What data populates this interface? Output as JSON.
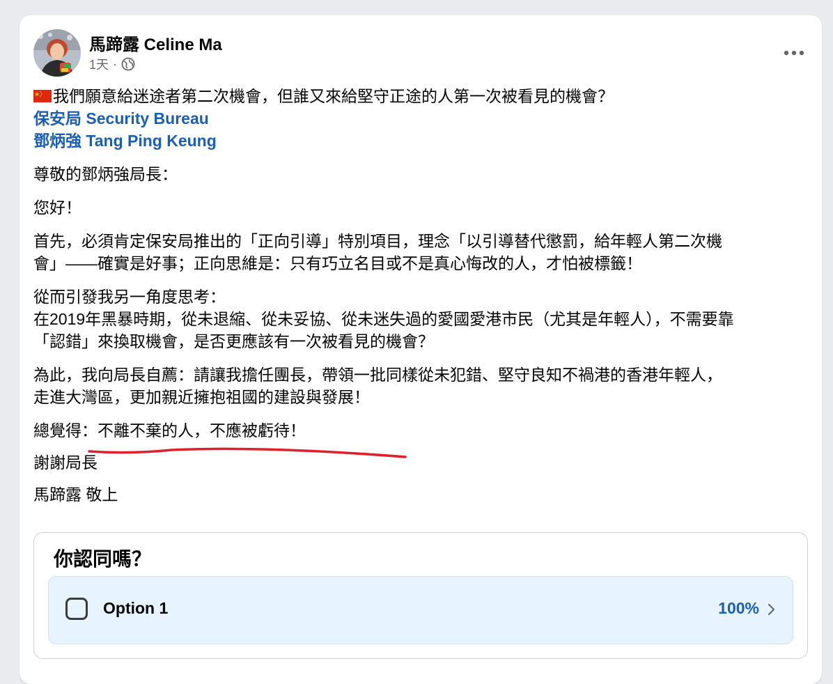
{
  "post": {
    "author": "馬蹄露 Celine Ma",
    "time": "1天",
    "separator": "·",
    "audience_icon": "globe-icon",
    "more_icon": "more-horizontal-icon"
  },
  "content": {
    "title": "我們願意給迷途者第二次機會，但誰又來給堅守正途的人第一次被看見的機會？",
    "flag_icon": "china-flag-icon",
    "tags": [
      "保安局 Security Bureau",
      "鄧炳強 Tang Ping Keung"
    ],
    "greeting": "尊敬的鄧炳強局長：",
    "hello": "您好！",
    "para1": [
      "首先，必須肯定保安局推出的「正向引導」特別項目，理念「以引導替代懲罰，給年輕人第二次機",
      "會」——確實是好事；正向思維是：只有巧立名目或不是真心悔改的人，才怕被標籤！"
    ],
    "para2": [
      "從而引發我另一角度思考：",
      "在2019年黑暴時期，從未退縮、從未妥協、從未迷失過的愛國愛港市民（尤其是年輕人），不需要靠",
      "「認錯」來換取機會，是否更應該有一次被看見的機會？"
    ],
    "para3": [
      "為此，我向局長自薦：請讓我擔任團長，帶領一批同樣從未犯錯、堅守良知不禍港的香港年輕人，",
      "走進大灣區，更加親近擁抱祖國的建設與發展！"
    ],
    "para4": "總覺得：不離不棄的人，不應被虧待！",
    "thanks": "謝謝局長",
    "signature": "馬蹄露 敬上"
  },
  "poll": {
    "question": "你認同嗎？",
    "options": [
      {
        "label": "Option 1",
        "percent": "100%",
        "checked": false
      }
    ]
  },
  "colors": {
    "link": "#1a5fb4",
    "underline": "#e0202a",
    "poll_option_bg": "#e7f3ff",
    "secondary_text": "#65676b"
  }
}
